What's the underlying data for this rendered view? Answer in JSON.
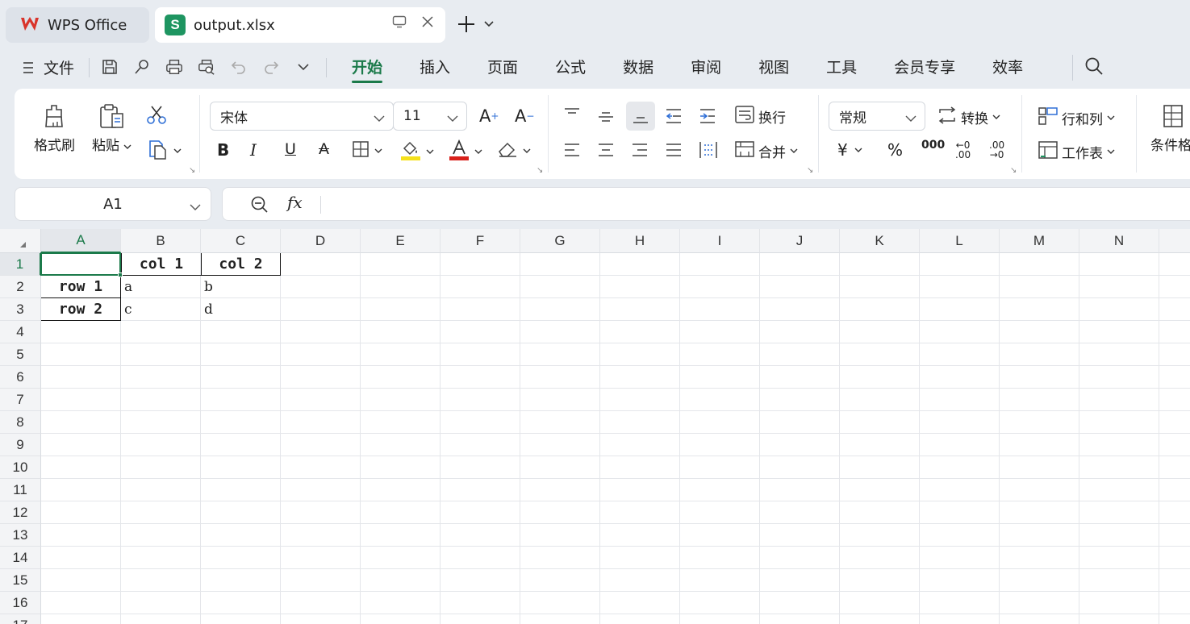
{
  "tabs": {
    "app_label": "WPS Office",
    "file_label": "output.xlsx"
  },
  "menu": {
    "file_label": "文件",
    "tabs": [
      {
        "label": "开始"
      },
      {
        "label": "插入"
      },
      {
        "label": "页面"
      },
      {
        "label": "公式"
      },
      {
        "label": "数据"
      },
      {
        "label": "审阅"
      },
      {
        "label": "视图"
      },
      {
        "label": "工具"
      },
      {
        "label": "会员专享"
      },
      {
        "label": "效率"
      }
    ],
    "active_tab": "开始"
  },
  "ribbon": {
    "format_painter": "格式刷",
    "paste": "粘贴",
    "font_name": "宋体",
    "font_size": "11",
    "wrap": "换行",
    "merge": "合并",
    "number_format": "常规",
    "convert": "转换",
    "rows_cols": "行和列",
    "worksheet": "工作表",
    "conditional": "条件格"
  },
  "formula_bar": {
    "name_box": "A1",
    "fx": "fx",
    "value": ""
  },
  "sheet": {
    "columns": [
      "A",
      "B",
      "C",
      "D",
      "E",
      "F",
      "G",
      "H",
      "I",
      "J",
      "K",
      "L",
      "M",
      "N"
    ],
    "rows": [
      "1",
      "2",
      "3",
      "4",
      "5",
      "6",
      "7",
      "8",
      "9",
      "10",
      "11",
      "12",
      "13",
      "14",
      "15",
      "16",
      "17"
    ],
    "active_cell": "A1",
    "cells": {
      "B1": "col 1",
      "C1": "col 2",
      "A2": "row 1",
      "B2": "a",
      "C2": "b",
      "A3": "row 2",
      "B3": "c",
      "C3": "d"
    }
  },
  "colors": {
    "accent": "#1b7a4a",
    "xlsx_icon": "#1e9561",
    "wps_logo": "#d9342b"
  }
}
